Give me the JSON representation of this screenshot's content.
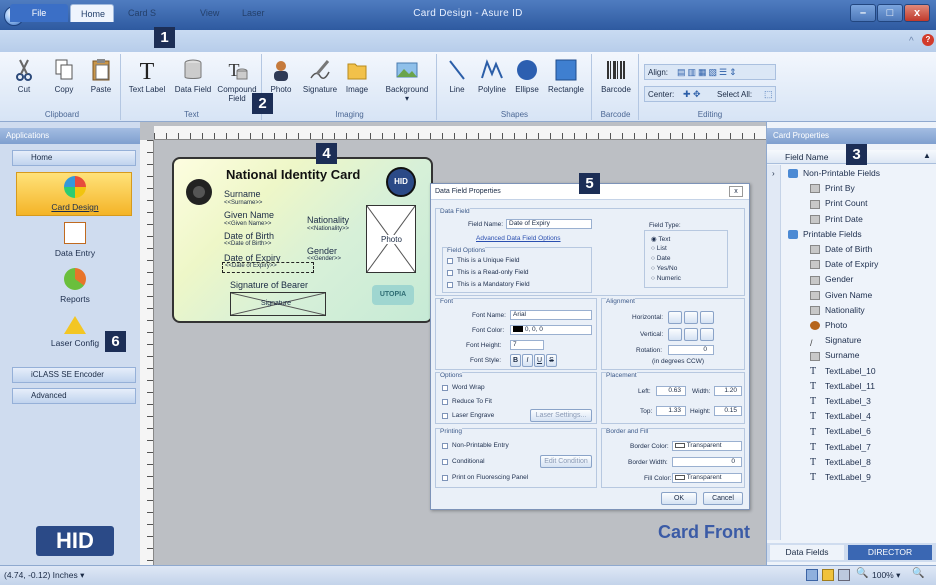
{
  "window": {
    "title": "Card Design - Asure ID"
  },
  "tabs": [
    {
      "label": "File"
    },
    {
      "label": "Home"
    },
    {
      "label": "Card S"
    },
    {
      "label": "View"
    },
    {
      "label": "Laser"
    }
  ],
  "ribbon": {
    "groups": [
      "Clipboard",
      "Text",
      "Imaging",
      "Shapes",
      "Barcode",
      "Editing"
    ],
    "clipboard": [
      "Cut",
      "Copy",
      "Paste"
    ],
    "text": [
      "Text Label",
      "Data Field",
      "Compound",
      "Field"
    ],
    "imaging": [
      "Photo",
      "Signature",
      "Image",
      "Background"
    ],
    "shapes": [
      "Line",
      "Polyline",
      "Ellipse",
      "Rectangle"
    ],
    "barcode": [
      "Barcode"
    ],
    "editing": {
      "align": "Align:",
      "center": "Center:",
      "select_all": "Select All:"
    }
  },
  "badges": [
    "1",
    "2",
    "3",
    "4",
    "5",
    "6"
  ],
  "left_panel": {
    "header": "Applications",
    "home": "Home",
    "items": [
      "Card Design",
      "Data Entry",
      "Reports",
      "Laser Config"
    ],
    "sections": [
      "iCLASS SE Encoder",
      "Advanced"
    ],
    "logo": "HID"
  },
  "card": {
    "title": "National Identity Card",
    "logo": "HID",
    "surname": "Surname",
    "surname_field": "<<Surname>>",
    "given": "Given Name",
    "given_field": "<<Given Name>>",
    "nationality": "Nationality",
    "nationality_field": "<<Nationality>>",
    "dob": "Date of Birth",
    "dob_field": "<<Date of Birth>>",
    "gender": "Gender",
    "gender_field": "<<Gender>>",
    "expiry": "Date of Expiry",
    "expiry_field": "<<Date of Expiry>>",
    "photo": "Photo",
    "sig_label": "Signature of Bearer",
    "signature": "Signature",
    "stamp": "UTOPIA"
  },
  "card_front": "Card Front",
  "dialog": {
    "title": "Data Field Properties",
    "data_field": "Data Field",
    "field_name_label": "Field Name:",
    "field_name": "Date of Expiry",
    "advanced_link": "Advanced Data Field Options",
    "field_type": "Field Type:",
    "types": [
      "Text",
      "List",
      "Date",
      "Yes/No",
      "Numeric"
    ],
    "field_options": "Field Options",
    "options": [
      "This is a Unique Field",
      "This is a Read-only Field",
      "This is a Mandatory Field"
    ],
    "font": "Font",
    "font_name_label": "Font Name:",
    "font_name": "Arial",
    "font_color_label": "Font Color:",
    "font_color": "0, 0, 0",
    "font_height_label": "Font Height:",
    "font_height": "7",
    "font_style_label": "Font Style:",
    "styles": [
      "B",
      "I",
      "U",
      "S"
    ],
    "alignment": "Alignment",
    "horizontal": "Horizontal:",
    "vertical": "Vertical:",
    "rotation": "Rotation:",
    "rotation_value": "0",
    "rotation_note": "(in degrees CCW)",
    "options_title": "Options",
    "text_options": [
      "Word Wrap",
      "Reduce To Fit",
      "Laser Engrave"
    ],
    "laser_settings": "Laser Settings...",
    "placement": "Placement",
    "left_label": "Left:",
    "left": "0.63",
    "width_label": "Width:",
    "width": "1.20",
    "top_label": "Top:",
    "top": "1.33",
    "height_label": "Height:",
    "height": "0.15",
    "printing": "Printing",
    "print_options": [
      "Non-Printable Entry",
      "Conditional",
      "Print on Fluorescing Panel"
    ],
    "edit_condition": "Edit Condition",
    "border_fill": "Border and Fill",
    "border_color_label": "Border Color:",
    "border_color": "Transparent",
    "border_width_label": "Border Width:",
    "border_width": "0",
    "fill_color_label": "Fill Color:",
    "fill_color": "Transparent",
    "ok": "OK",
    "cancel": "Cancel"
  },
  "right_panel": {
    "header": "Card Properties",
    "column": "Field Name",
    "non_printable": "Non-Printable Fields",
    "np_items": [
      "Print By",
      "Print Count",
      "Print Date"
    ],
    "printable": "Printable Fields",
    "p_items": [
      "Date of Birth",
      "Date of Expiry",
      "Gender",
      "Given Name",
      "Nationality",
      "Photo",
      "Signature",
      "Surname",
      "TextLabel_10",
      "TextLabel_11",
      "TextLabel_3",
      "TextLabel_4",
      "TextLabel_6",
      "TextLabel_7",
      "TextLabel_8",
      "TextLabel_9"
    ],
    "tabs": [
      "Data Fields",
      "DIRECTOR"
    ]
  },
  "status": {
    "coords": "(4.74, -0.12) Inches",
    "zoom": "100%"
  }
}
